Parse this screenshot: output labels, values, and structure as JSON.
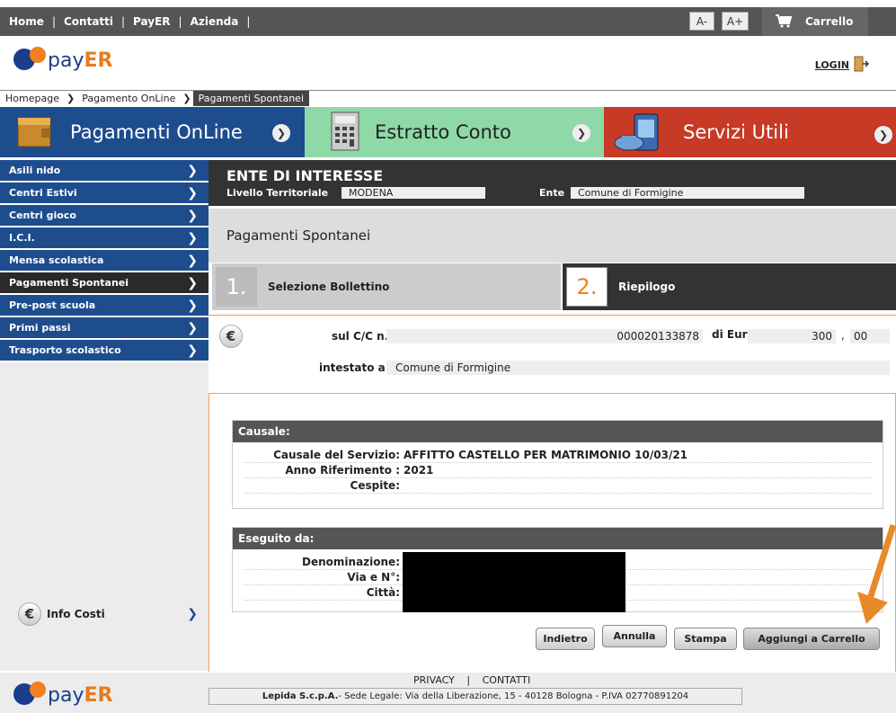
{
  "topnav": {
    "home": "Home",
    "contatti": "Contatti",
    "payer": "PayER",
    "azienda": "Azienda",
    "sep": "|"
  },
  "fontsize": {
    "decrease": "A-",
    "increase": "A+"
  },
  "cart": {
    "label": "Carrello"
  },
  "header": {
    "logo_text_1": "pay",
    "logo_text_2": "ER",
    "login": "LOGIN"
  },
  "breadcrumb": [
    "Homepage",
    "Pagamento OnLine",
    "Pagamenti Spontanei"
  ],
  "tabs": [
    {
      "label": "Pagamenti OnLine",
      "color": "#1e4d8e"
    },
    {
      "label": "Estratto Conto",
      "color": "#8fd9a8"
    },
    {
      "label": "Servizi Utili",
      "color": "#c63a26"
    }
  ],
  "sidebar": {
    "items": [
      {
        "label": "Asili nido"
      },
      {
        "label": "Centri Estivi"
      },
      {
        "label": "Centri gioco"
      },
      {
        "label": "I.C.I."
      },
      {
        "label": "Mensa scolastica"
      },
      {
        "label": "Pagamenti Spontanei",
        "active": true
      },
      {
        "label": "Pre-post scuola"
      },
      {
        "label": "Primi passi"
      },
      {
        "label": "Trasporto scolastico"
      }
    ],
    "info_costi": "Info Costi"
  },
  "ente": {
    "title": "ENTE DI INTERESSE",
    "livello_label": "Livello Territoriale",
    "livello_value": "MODENA",
    "ente_label": "Ente",
    "ente_value": "Comune di Formigine"
  },
  "page_title": "Pagamenti Spontanei",
  "steps": [
    {
      "num": "1.",
      "label": "Selezione Bollettino"
    },
    {
      "num": "2.",
      "label": "Riepilogo"
    }
  ],
  "payment": {
    "cc_label": "sul C/C n.",
    "cc_value": "000020133878",
    "euro_label": "di Euro",
    "euro_int": "300",
    "euro_sep": ",",
    "euro_dec": "00",
    "intestato_label": "intestato a:",
    "intestato_value": "Comune di Formigine"
  },
  "causale": {
    "header": "Causale:",
    "rows": [
      {
        "label": "Causale del Servizio:",
        "value": "AFFITTO CASTELLO PER MATRIMONIO 10/03/21"
      },
      {
        "label": "Anno Riferimento :",
        "value": "2021"
      },
      {
        "label": "Cespite:",
        "value": ""
      }
    ]
  },
  "eseguito": {
    "header": "Eseguito da:",
    "rows": [
      {
        "label": "Denominazione:"
      },
      {
        "label": "Via e N°:"
      },
      {
        "label": "Città:"
      }
    ]
  },
  "buttons": {
    "indietro": "Indietro",
    "annulla": "Annulla",
    "stampa": "Stampa",
    "aggiungi": "Aggiungi a Carrello"
  },
  "footer": {
    "privacy": "PRIVACY",
    "sep": "|",
    "contatti": "CONTATTI",
    "company": "Lepida S.c.p.A.",
    "address": " - Sede Legale: Via della Liberazione, 15 - 40128 Bologna - P.IVA 02770891204"
  }
}
